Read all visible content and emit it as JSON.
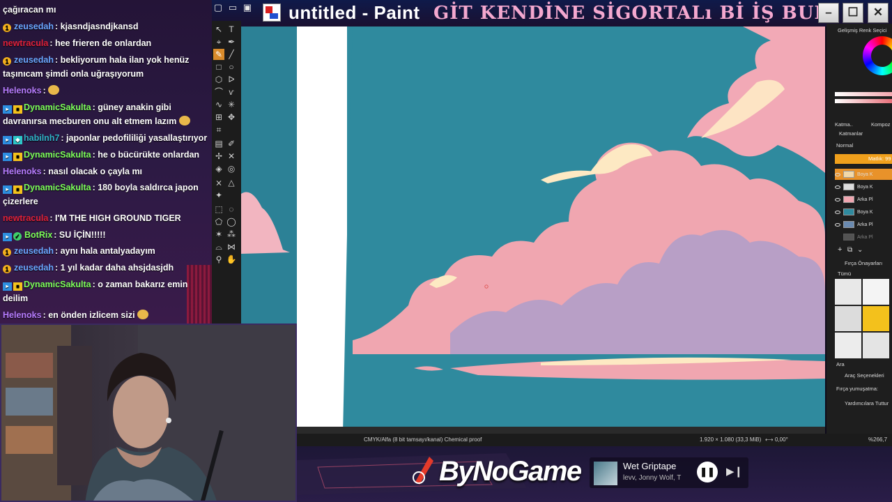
{
  "chat": {
    "messages": [
      {
        "user": "",
        "text": "çağıracan mı"
      },
      {
        "user": "zeusedah",
        "text": ": kjasndjasndjkansd"
      },
      {
        "user": "newtracula",
        "text": ": hee frieren de onlardan"
      },
      {
        "user": "zeusedah",
        "text": ": bekliyorum hala ilan yok henüz taşınıcam şimdi onla uğraşıyorum"
      },
      {
        "user": "Helenoks",
        "text": ":"
      },
      {
        "user": "DynamicSakulta",
        "text": ": güney anakin gibi davranırsa mecburen onu alt etmem lazım"
      },
      {
        "user": "habilnh7",
        "text": ": japonlar pedofililiği yasallaştırıyor"
      },
      {
        "user": "DynamicSakulta",
        "text": ": he o bücürükte onlardan"
      },
      {
        "user": "Helenoks",
        "text": ": nasıl olacak o çayla mı"
      },
      {
        "user": "DynamicSakulta",
        "text": ": 180 boyla saldırca japon çizerlere"
      },
      {
        "user": "newtracula",
        "text": ": I'M THE HIGH GROUND TIGER"
      },
      {
        "user": "BotRix",
        "text": ": SU İÇİN!!!!!"
      },
      {
        "user": "zeusedah",
        "text": ": aynı hala antalyadayım"
      },
      {
        "user": "zeusedah",
        "text": ": 1 yıl kadar daha ahsjdasjdh"
      },
      {
        "user": "DynamicSakulta",
        "text": ": o zaman bakarız emin deilim"
      },
      {
        "user": "Helenoks",
        "text": ": en önden izlicem sizi"
      }
    ]
  },
  "window": {
    "title": "untitled - Paint",
    "stream_title": "GİT KENDİNE SİGORTALı Bİ İŞ BUL",
    "minimize": "–",
    "maximize": "☐",
    "close": "✕"
  },
  "status": {
    "color_mode": "CMYK/Alfa (8 bit tamsayı/kanal) Chemical proof",
    "dimensions": "1.920 × 1.080 (33,3 MiB)",
    "rotation": "0,00°",
    "zoom": "%266,7"
  },
  "dock": {
    "color_selector": "Gelişmiş Renk Seçici",
    "tab_a": "Katma..",
    "tab_b": "Kompoz",
    "layers_title": "Katmanlar",
    "blend_mode": "Normal",
    "opacity": "Matlık: 99",
    "layers": [
      "Boya K",
      "Boya K",
      "Arka Pl",
      "Boya K",
      "Arka Pl",
      "Arka Pl"
    ],
    "brush_presets": "Fırça Önayarları",
    "brush_filter": "Tümü",
    "search": "Ara",
    "tool_options": "Araç Seçenekleri",
    "smoothing": "Fırça yumuşatma:",
    "assist": "Yardımcılara Tuttur"
  },
  "banner": {
    "brand": "ByNoGame",
    "song_title": "Wet Griptape",
    "song_artist": "levv, Jonny Wolf, T",
    "pause": "❚❚",
    "next": "▶❙"
  },
  "colors": {
    "sky": "#2f8a9e",
    "cloud_pink": "#f0a6b0",
    "cloud_shadow": "#b89fc6",
    "cloud_highlight": "#fde9c3",
    "accent_orange": "#f0a01c"
  }
}
